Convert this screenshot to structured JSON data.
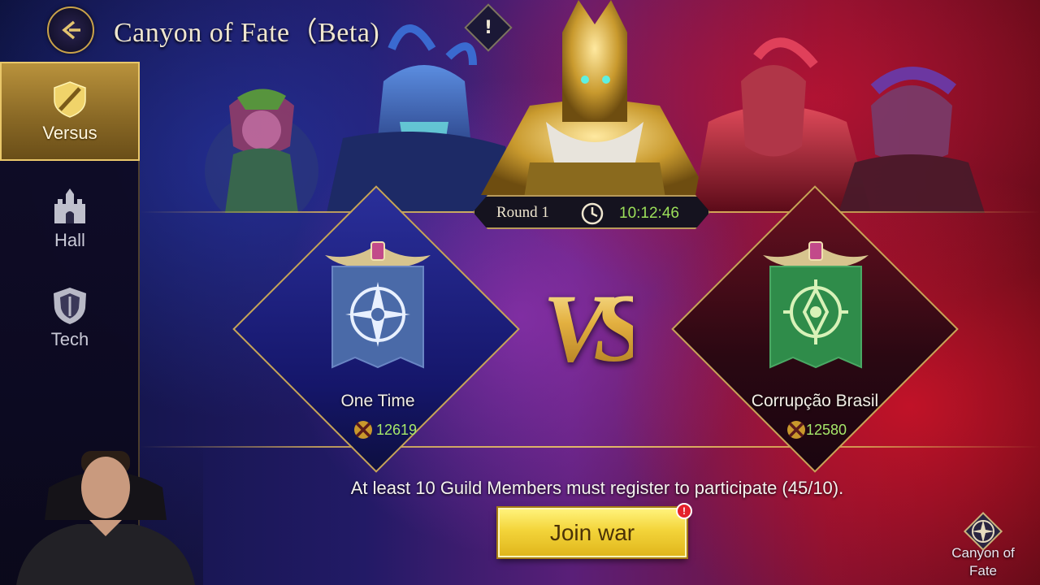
{
  "header": {
    "title": "Canyon of Fate（Beta)",
    "info_symbol": "!"
  },
  "sidebar": {
    "items": [
      {
        "label": "Versus",
        "icon": "shield-sword-icon",
        "active": true
      },
      {
        "label": "Hall",
        "icon": "castle-icon",
        "active": false
      },
      {
        "label": "Tech",
        "icon": "crest-shield-icon",
        "active": false
      }
    ]
  },
  "round": {
    "label": "Round 1",
    "timer": "10:12:46"
  },
  "teams": {
    "left": {
      "name": "One Time",
      "score": "12619",
      "banner_color": "#4a6aa8",
      "emblem": "compass-emblem-icon"
    },
    "right": {
      "name": "Corrupção Brasil",
      "score": "12580",
      "banner_color": "#2f8c4a",
      "emblem": "eye-emblem-icon"
    }
  },
  "vs_text": "VS",
  "requirement_text": "At least 10 Guild Members must register to participate (45/10).",
  "join_button": {
    "label": "Join war",
    "badge": "!"
  },
  "bottom_right_link": {
    "label": "Canyon of Fate"
  },
  "colors": {
    "gold_accent": "#c9a24a",
    "score_green": "#a6e86a",
    "timer_green": "#9ce05a",
    "join_yellow": "#f3d43a"
  }
}
